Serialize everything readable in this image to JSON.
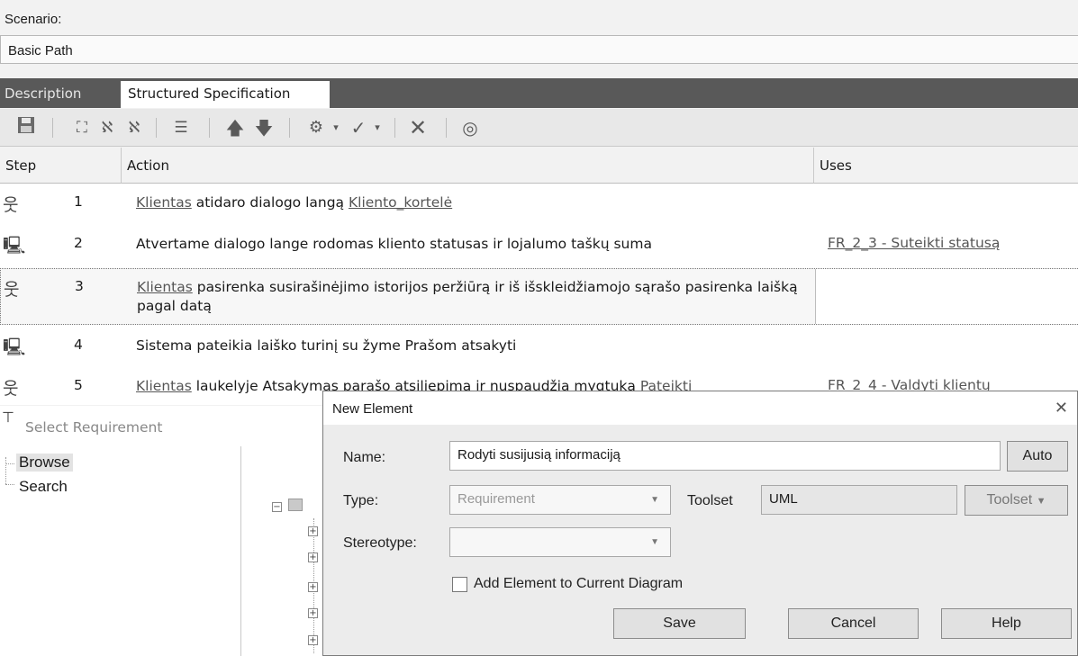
{
  "scenario": {
    "label": "Scenario:",
    "value": "Basic Path"
  },
  "tabs": [
    {
      "label": "Description"
    },
    {
      "label": "Structured Specification"
    }
  ],
  "toolbar": {
    "icons": [
      "save-icon",
      "insert-step-icon",
      "insert-actor-step-icon",
      "insert-system-step-icon",
      "indent-icon",
      "move-up-icon",
      "move-down-icon",
      "generate-icon",
      "validate-icon",
      "delete-icon",
      "help-icon"
    ]
  },
  "grid": {
    "columns": {
      "step": "Step",
      "action": "Action",
      "uses": "Uses"
    },
    "rows": [
      {
        "type": "actor",
        "num": "1",
        "a_link1": "Klientas",
        "a_text1": " atidaro dialogo langą ",
        "a_link2": "Kliento_kortelė",
        "uses": ""
      },
      {
        "type": "system",
        "num": "2",
        "a_text1": "Atvertame dialogo lange rodomas kliento statusas ir lojalumo taškų suma",
        "uses": "FR_2_3 - Suteikti statusą"
      },
      {
        "type": "actor",
        "num": "3",
        "a_link1": "Klientas",
        "a_text1": " pasirenka susirašinėjimo istorijos peržiūrą ir iš išskleidžiamojo sąrašo pasirenka laišką pagal datą",
        "uses": ""
      },
      {
        "type": "system",
        "num": "4",
        "a_text1": "Sistema pateikia laiško turinį su žyme Prašom atsakyti",
        "uses": ""
      },
      {
        "type": "actor",
        "num": "5",
        "a_link1": "Klientas",
        "a_text1": " laukelyje Atsakymas parašo atsiliepimą ir nuspaudžia mygtuką ",
        "a_link2": "Pateikti",
        "uses": "FR_2_4 - Valdyti klientų"
      }
    ]
  },
  "select_requirement": {
    "title": "Select Requirement",
    "tree": [
      "Browse",
      "Search"
    ]
  },
  "dialog": {
    "title": "New Element",
    "name_label": "Name:",
    "name_value": "Rodyti susijusią informaciją",
    "auto_button": "Auto",
    "type_label": "Type:",
    "type_value": "Requirement",
    "toolset_label": "Toolset",
    "toolset_value": "UML",
    "toolset_button": "Toolset",
    "stereotype_label": "Stereotype:",
    "stereotype_value": "",
    "checkbox_label": "Add Element to Current Diagram",
    "checkbox_checked": false,
    "save_button": "Save",
    "cancel_button": "Cancel",
    "help_button": "Help"
  }
}
